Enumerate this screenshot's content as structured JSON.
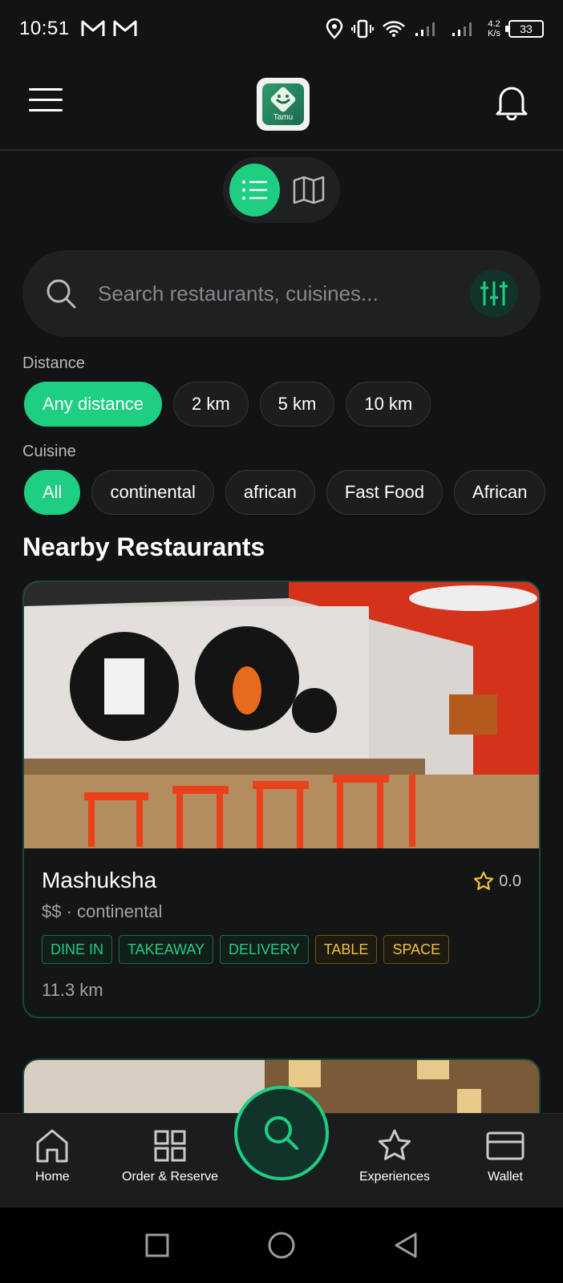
{
  "status_bar": {
    "time": "10:51",
    "net_speed_value": "4.2",
    "net_speed_unit": "K/s",
    "battery": "33"
  },
  "app_bar": {
    "logo_text": "Tamu"
  },
  "search": {
    "placeholder": "Search restaurants, cuisines..."
  },
  "filters": {
    "distance_label": "Distance",
    "distance_options": [
      "Any distance",
      "2 km",
      "5 km",
      "10 km"
    ],
    "cuisine_label": "Cuisine",
    "cuisine_options": [
      "All",
      "continental",
      "african",
      "Fast Food",
      "African"
    ]
  },
  "section_title": "Nearby Restaurants",
  "restaurant": {
    "name": "Mashuksha",
    "rating": "0.0",
    "meta": "$$ · continental",
    "tags": [
      "DINE IN",
      "TAKEAWAY",
      "DELIVERY",
      "TABLE",
      "SPACE"
    ],
    "distance": "11.3 km"
  },
  "bottom_nav": {
    "home": "Home",
    "order": "Order & Reserve",
    "experiences": "Experiences",
    "wallet": "Wallet"
  },
  "colors": {
    "accent": "#1ecf82",
    "background": "#121314",
    "amber": "#f2c232"
  }
}
